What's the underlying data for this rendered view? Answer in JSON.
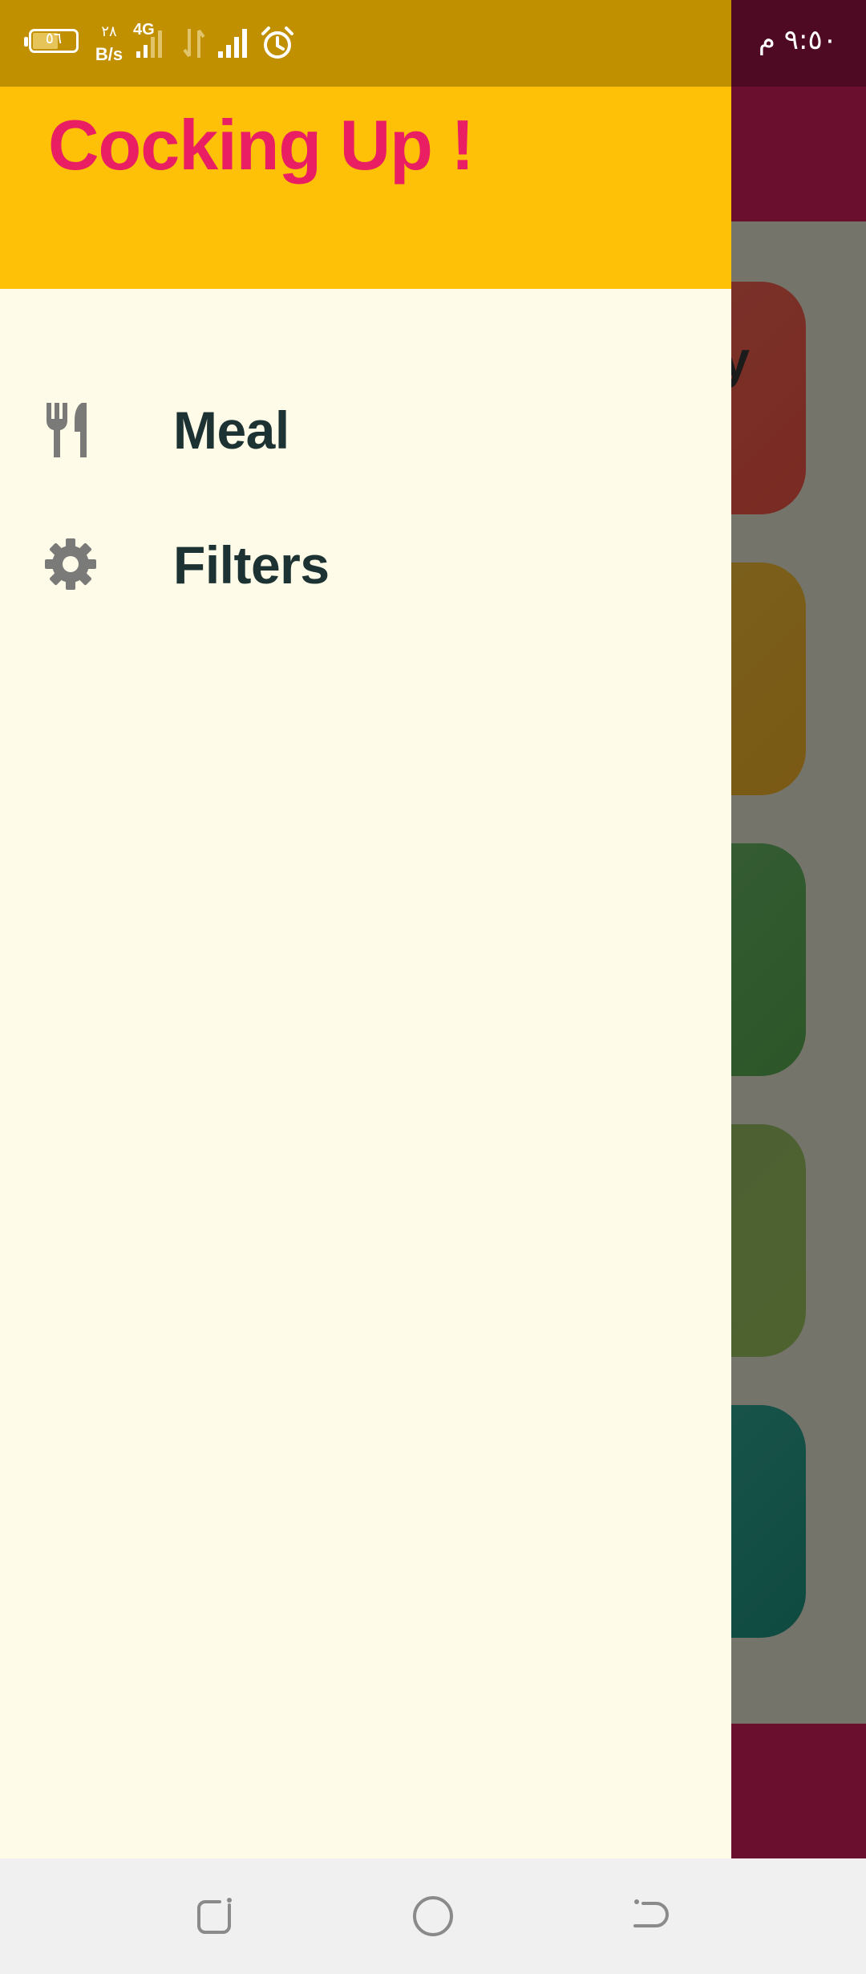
{
  "status_bar": {
    "time": "٩:٥٠ م",
    "battery_level": "٥٦",
    "net_speed_value": "٢٨",
    "net_speed_unit": "B/s",
    "network_type": "4G"
  },
  "drawer": {
    "title": "Cocking Up !",
    "items": [
      {
        "label": "Meal",
        "icon": "restaurant-icon"
      },
      {
        "label": "Filters",
        "icon": "gear-icon"
      }
    ]
  },
  "background_cards": {
    "peek_text": "y",
    "colors": [
      "#7a3128",
      "#7a5f1c",
      "#3a5e37",
      "#4c5e32",
      "#1f534b"
    ]
  },
  "colors": {
    "drawer_header": "#ffc107",
    "drawer_title": "#e91e63",
    "drawer_body": "#fefce9",
    "item_text": "#1d3232",
    "app_bar": "#6b0f2e"
  },
  "nav_bar": {
    "buttons": [
      "recents-icon",
      "home-icon",
      "back-icon"
    ]
  }
}
